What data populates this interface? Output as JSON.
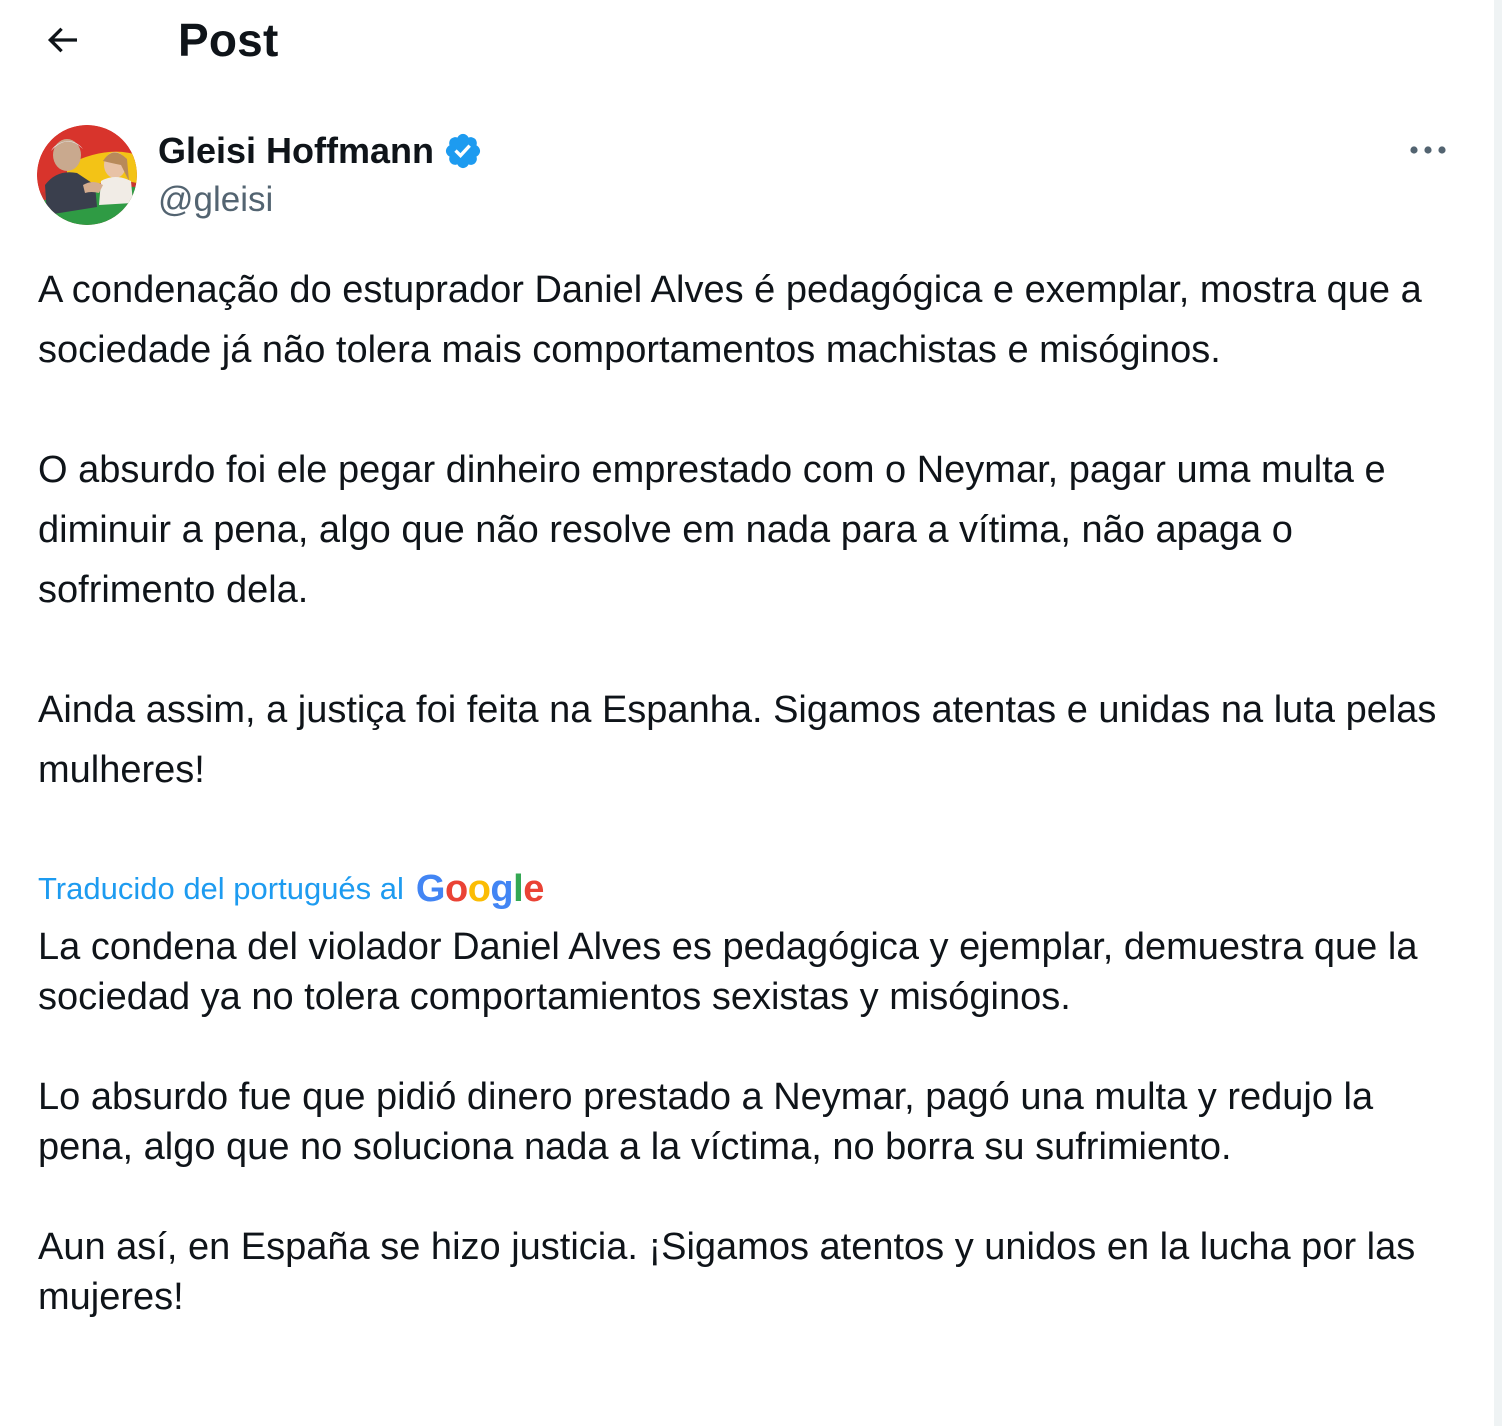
{
  "header": {
    "title": "Post",
    "back_icon": "arrow-left-icon"
  },
  "post": {
    "author": {
      "name": "Gleisi Hoffmann",
      "handle": "@gleisi",
      "verified": true,
      "verified_color": "#1d9bf0"
    },
    "more_icon": "more-horizontal-icon",
    "text": "A condenação do estuprador Daniel Alves é pedagógica e exemplar, mostra que a sociedade já não tolera mais comportamentos machistas e misóginos.\n\nO absurdo foi ele pegar dinheiro emprestado com o Neymar, pagar uma multa e diminuir a pena, algo que não resolve em nada para a vítima, não apaga o sofrimento dela.\n\nAinda assim, a justiça foi feita na Espanha. Sigamos atentas e unidas na luta pelas mulheres!",
    "translation": {
      "label": "Traducido del portugués al",
      "provider": "Google",
      "link_color": "#1d9bf0",
      "text": "La condena del violador Daniel Alves es pedagógica y ejemplar, demuestra que la sociedad ya no tolera comportamientos sexistas y misóginos.\n\nLo absurdo fue que pidió dinero prestado a Neymar, pagó una multa y redujo la pena, algo que no soluciona nada a la víctima, no borra su sufrimiento.\n\nAun así, en España se hizo justicia. ¡Sigamos atentos y unidos en la lucha por las mujeres!"
    }
  }
}
